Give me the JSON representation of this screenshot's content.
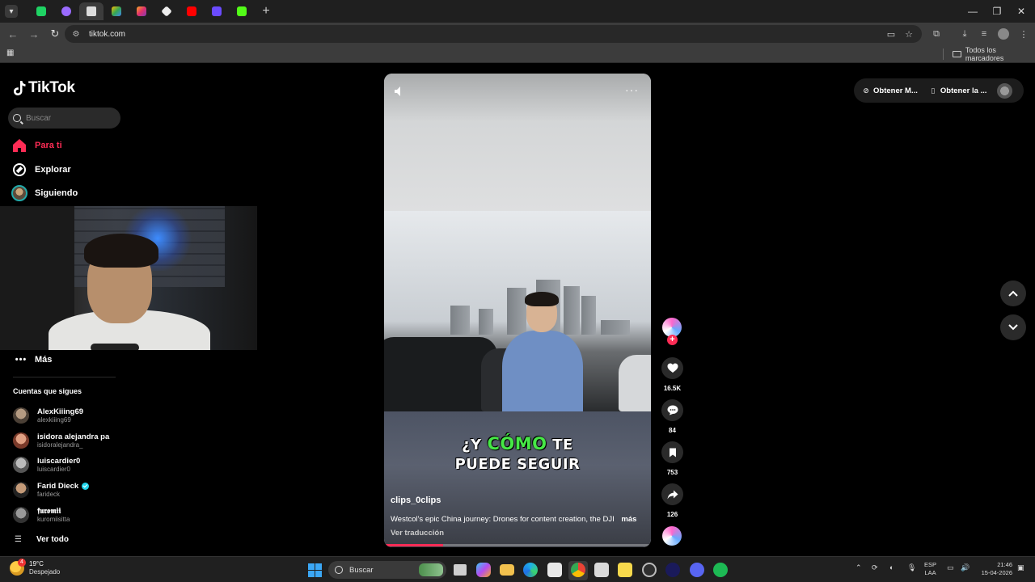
{
  "browser": {
    "url": "tiktok.com",
    "bookmarks_all_label": "Todos los marcadores"
  },
  "tiktok": {
    "logo_text": "TikTok",
    "search_placeholder": "Buscar",
    "nav": {
      "for_you": "Para ti",
      "explore": "Explorar",
      "following": "Siguiendo",
      "more": "Más"
    },
    "accounts_section_title": "Cuentas que sigues",
    "accounts": [
      {
        "name": "AlexKiiing69",
        "handle": "alexkiiing69"
      },
      {
        "name": "isidora alejandra pa",
        "handle": "isidoralejandra_"
      },
      {
        "name": "luiscardier0",
        "handle": "luiscardier0"
      },
      {
        "name": "Farid Dieck",
        "handle": "farideck"
      },
      {
        "name": "𝖋𝖚𝖗𝖔𝖒𝖎𝖎",
        "handle": "kuromiisitta"
      }
    ],
    "see_all": "Ver todo",
    "top_actions": {
      "get_coins": "Obtener M...",
      "get_app": "Obtener la ..."
    },
    "video": {
      "caption_line1_a": "¿Y",
      "caption_line1_highlight": "CÓMO",
      "caption_line1_b": "TE",
      "caption_line2": "PUEDE SEGUIR",
      "author": "clips_0clips",
      "description": "Westcol's epic China journey: Drones for content creation, the DJI",
      "more_label": "más",
      "translate_label": "Ver traducción",
      "progress": 0.22
    },
    "actions": {
      "likes": "16.5K",
      "comments": "84",
      "saves": "753",
      "shares": "126"
    }
  },
  "taskbar": {
    "temperature": "19°C",
    "weather_desc": "Despejado",
    "weather_badge": "4",
    "search_placeholder": "Buscar",
    "lang_line1": "ESP",
    "lang_line2": "LAA",
    "time": "21:46",
    "date": "15-04-2026"
  },
  "colors": {
    "accent": "#fe2c55",
    "caption_highlight": "#46e846",
    "verified": "#20d5ec"
  }
}
